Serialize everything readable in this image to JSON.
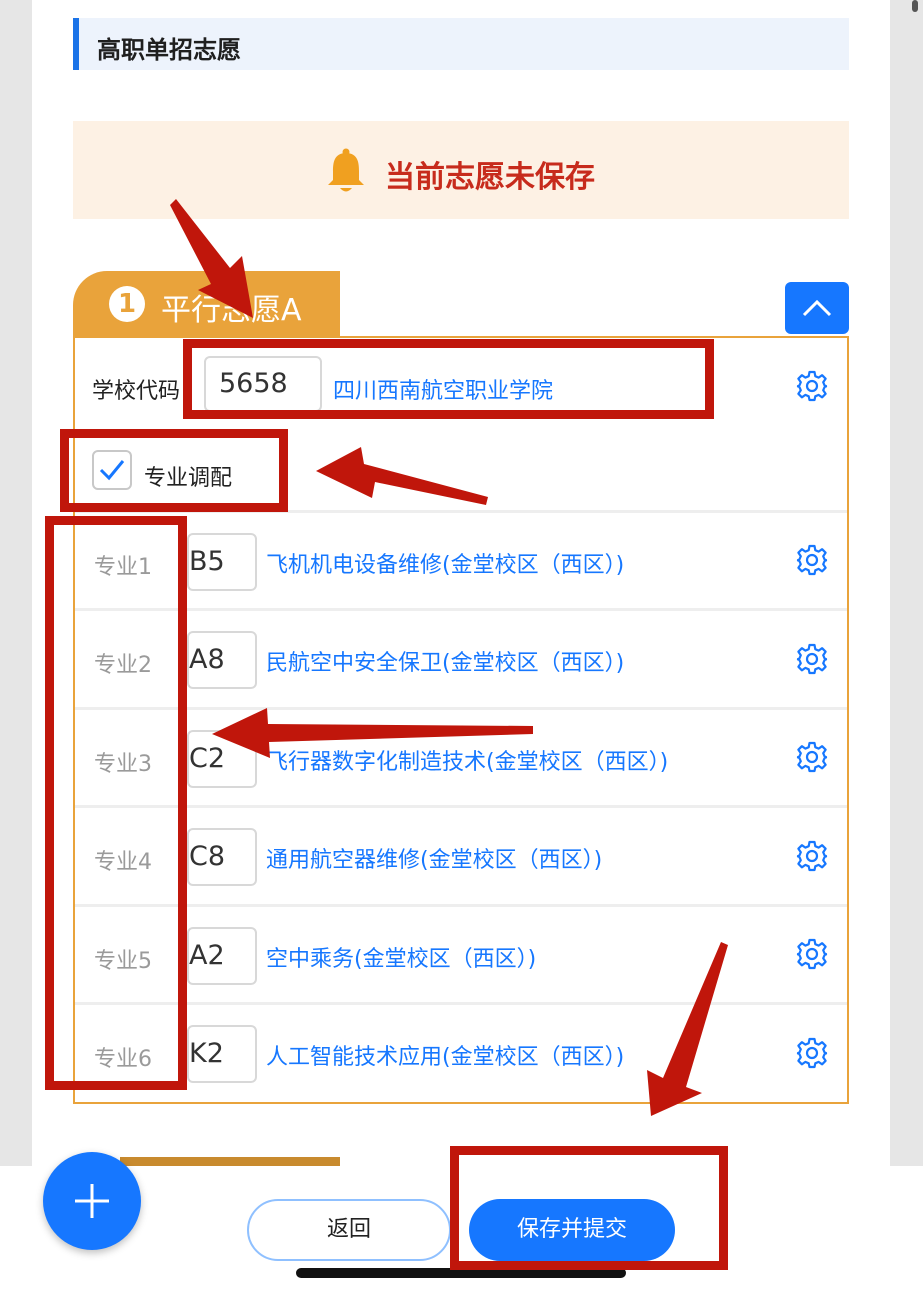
{
  "section": {
    "title": "高职单招志愿"
  },
  "notice": {
    "text": "当前志愿未保存"
  },
  "tab": {
    "number": "1",
    "label": "平行志愿A"
  },
  "school": {
    "label": "学校代码",
    "code": "5658",
    "name": "四川西南航空职业学院"
  },
  "adjust": {
    "label": "专业调配",
    "checked": true
  },
  "majors": [
    {
      "label": "专业1",
      "code": "B5",
      "name": "飞机机电设备维修(金堂校区（西区）)"
    },
    {
      "label": "专业2",
      "code": "A8",
      "name": "民航空中安全保卫(金堂校区（西区）)"
    },
    {
      "label": "专业3",
      "code": "C2",
      "name": "飞行器数字化制造技术(金堂校区（西区）)"
    },
    {
      "label": "专业4",
      "code": "C8",
      "name": "通用航空器维修(金堂校区（西区）)"
    },
    {
      "label": "专业5",
      "code": "A2",
      "name": "空中乘务(金堂校区（西区）)"
    },
    {
      "label": "专业6",
      "code": "K2",
      "name": "人工智能技术应用(金堂校区（西区）)"
    }
  ],
  "footer": {
    "back_label": "返回",
    "submit_label": "保存并提交"
  },
  "icons": {
    "notice": "bell-icon",
    "collapse": "chevron-up-icon",
    "settings": "gear-icon",
    "checkbox": "check-icon",
    "add": "plus-icon"
  },
  "colors": {
    "primary": "#1677ff",
    "tab": "#e9a33b",
    "notice_text": "#c72b1c",
    "notice_bg": "#fdf1e4",
    "annotation": "#c0160b"
  }
}
